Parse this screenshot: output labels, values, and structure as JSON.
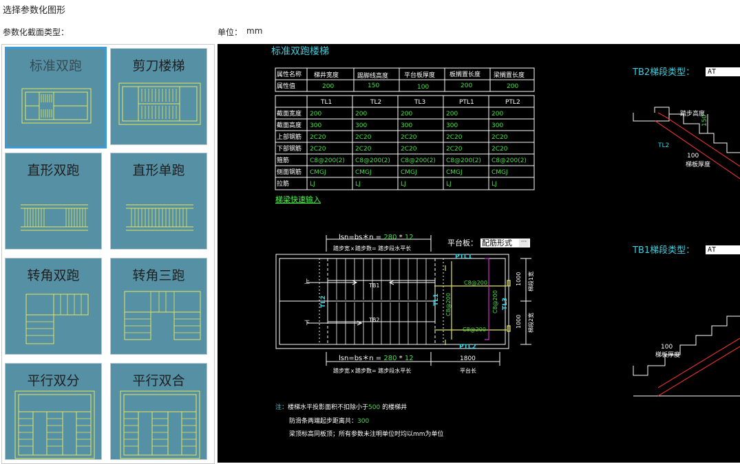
{
  "window": {
    "title": "选择参数化图形"
  },
  "header": {
    "section_type_label": "参数化截面类型：",
    "unit_label": "单位：",
    "unit_value": "mm"
  },
  "gallery": {
    "items": [
      "标准双跑",
      "剪刀楼梯",
      "直形双跑",
      "直形单跑",
      "转角双跑",
      "转角三跑",
      "平行双分",
      "平行双合"
    ],
    "selected": "标准双跑"
  },
  "drawing": {
    "title": "标准双跑楼梯",
    "attr_table": {
      "headers": [
        "属性名称",
        "梯井宽度",
        "踢脚线高度",
        "平台板厚度",
        "板搁置长度",
        "梁搁置长度"
      ],
      "row_label": "属性值",
      "values": [
        "200",
        "150",
        "100",
        "200",
        "200"
      ]
    },
    "beam_table": {
      "columns": [
        "TL1",
        "TL2",
        "TL3",
        "PTL1",
        "PTL2"
      ],
      "rows": [
        {
          "label": "截面宽度",
          "values": [
            "200",
            "200",
            "200",
            "200",
            "200"
          ]
        },
        {
          "label": "截面高度",
          "values": [
            "300",
            "300",
            "300",
            "300",
            "300"
          ]
        },
        {
          "label": "上部钢筋",
          "values": [
            "2C20",
            "2C20",
            "2C20",
            "2C20",
            "2C20"
          ]
        },
        {
          "label": "下部钢筋",
          "values": [
            "2C20",
            "2C20",
            "2C20",
            "2C20",
            "2C20"
          ]
        },
        {
          "label": "箍筋",
          "values": [
            "C8@200(2)",
            "C8@200(2)",
            "C8@200(2)",
            "C8@200(2)",
            "C8@200(2)"
          ]
        },
        {
          "label": "侧面钢筋",
          "values": [
            "CMGJ",
            "CMGJ",
            "CMGJ",
            "CMGJ",
            "CMGJ"
          ]
        },
        {
          "label": "拉筋",
          "values": [
            "LJ",
            "LJ",
            "LJ",
            "LJ",
            "LJ"
          ]
        }
      ]
    },
    "quick_input_link": "梯梁快速输入",
    "platform_label": "平台板：",
    "platform_value": "配筋形式",
    "platform_btn": "···",
    "plan": {
      "lsn_prefix": "lsn=bs＊n =",
      "bs": "280",
      "times": "*",
      "n": "12",
      "lsn_note": "踏步宽ｘ踏步数= 踏步段水平长",
      "platform_len": "1800",
      "platform_len_label": "平台长",
      "tb1": "TB1",
      "tb2": "TB2",
      "up": "上",
      "down": "下",
      "tl1": "TL1",
      "tl2": "TL2",
      "tl3": "TL3",
      "ptl1": "PTL1",
      "ptl2": "PTL2",
      "rebar": "C8@200",
      "w1": "1000",
      "w2": "1000",
      "w1_label": "梯段1宽",
      "w2_label": "梯段2宽"
    },
    "tb2_type_label": "TB2梯段类型：",
    "tb2_type_value": "AT",
    "tb1_type_label": "TB1梯段类型：",
    "tb1_type_value": "AT",
    "section_upper": {
      "step_height_label": "踏步高度",
      "step_height": "150",
      "slab_thickness": "100",
      "slab_thickness_label": "梯板厚度",
      "beam": "TL2"
    },
    "section_lower": {
      "slab_thickness": "100",
      "slab_thickness_label": "梯板厚度"
    },
    "notes": {
      "note_prefix": "注：",
      "line1a": "楼梯水平投影面积不扣除小于",
      "line1b": "500",
      "line1c": " 的楼梯井",
      "line2a": "防滑条两端起步距离共：",
      "line2b": "300",
      "line3": "梁顶标高同板顶；所有参数未注明单位时均以mm为单位"
    }
  }
}
